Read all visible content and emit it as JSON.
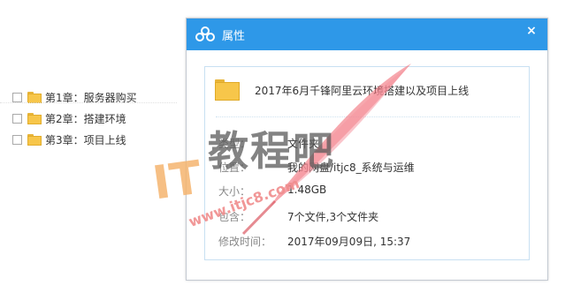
{
  "file_list": [
    {
      "name": "第1章：服务器购买"
    },
    {
      "name": "第2章：搭建环境"
    },
    {
      "name": "第3章：项目上线"
    }
  ],
  "dialog": {
    "title": "属性",
    "close_glyph": "×",
    "folder_name": "2017年6月千锋阿里云环境搭建以及项目上线",
    "properties": [
      {
        "label": "类型：",
        "value": "文件夹"
      },
      {
        "label": "位置：",
        "value": "我的网盘/itjc8_系统与运维"
      },
      {
        "label": "大小：",
        "value": "1.48GB"
      },
      {
        "label": "包含：",
        "value": "7个文件,3个文件夹"
      },
      {
        "label": "修改时间：",
        "value": "2017年09月09日, 15:37"
      }
    ]
  },
  "watermark": {
    "it": "IT",
    "chars": "教程吧",
    "url": "www.itjc8.com"
  },
  "colors": {
    "titlebar": "#2e98e8",
    "folder": "#f7c64a"
  },
  "icons": {
    "title_logo": "baidu-cloud-icon",
    "close": "close-icon",
    "folder": "folder-icon"
  }
}
